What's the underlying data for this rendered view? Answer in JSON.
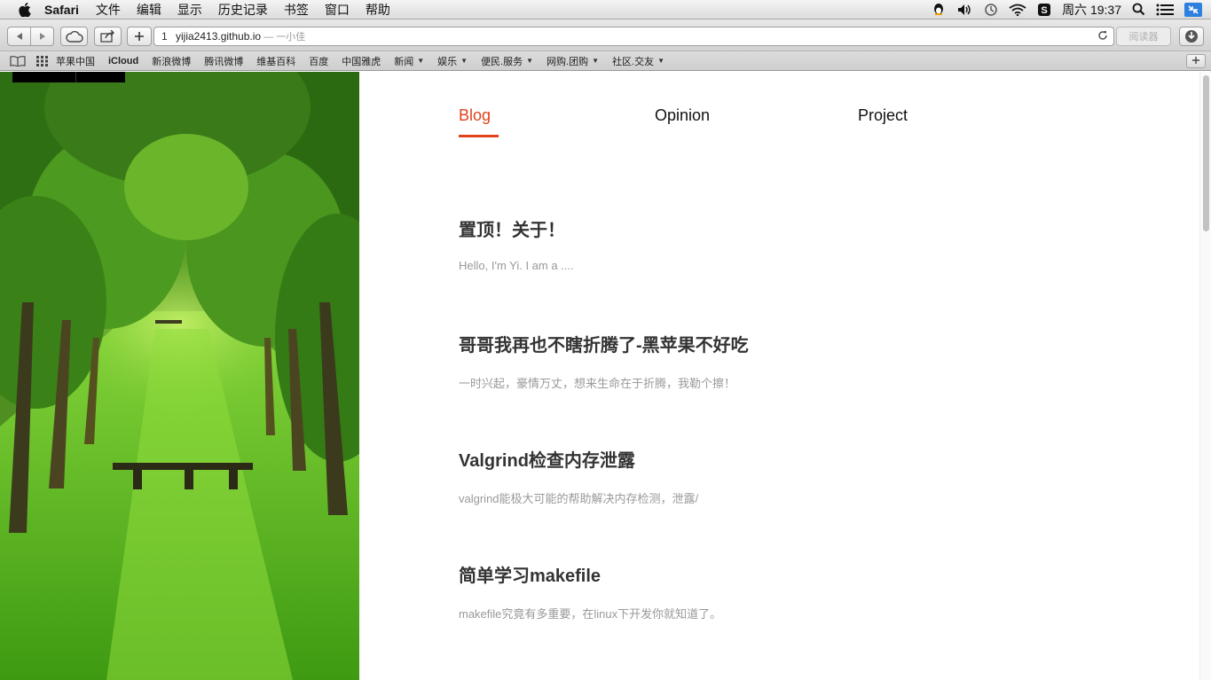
{
  "menubar": {
    "app_name": "Safari",
    "items": [
      "文件",
      "编辑",
      "显示",
      "历史记录",
      "书签",
      "窗口",
      "帮助"
    ],
    "clock": "周六 19:37"
  },
  "toolbar": {
    "tab_count": "1",
    "url_host": "yijia2413.github.io",
    "page_title": "— 一小佳",
    "reader_label": "阅读器"
  },
  "bookmarks": {
    "items": [
      {
        "label": "苹果中国",
        "dropdown": false
      },
      {
        "label": "iCloud",
        "dropdown": false
      },
      {
        "label": "新浪微博",
        "dropdown": false
      },
      {
        "label": "腾讯微博",
        "dropdown": false
      },
      {
        "label": "维基百科",
        "dropdown": false
      },
      {
        "label": "百度",
        "dropdown": false
      },
      {
        "label": "中国雅虎",
        "dropdown": false
      },
      {
        "label": "新闻",
        "dropdown": true
      },
      {
        "label": "娱乐",
        "dropdown": true
      },
      {
        "label": "便民.服务",
        "dropdown": true
      },
      {
        "label": "网购.团购",
        "dropdown": true
      },
      {
        "label": "社区.交友",
        "dropdown": true
      }
    ]
  },
  "nav": {
    "blog": "Blog",
    "opinion": "Opinion",
    "project": "Project",
    "active": "Blog",
    "accent_color": "#e0421b"
  },
  "posts": [
    {
      "title": "置顶！关于！",
      "excerpt": "Hello, I'm Yi. I am a ...."
    },
    {
      "title": "哥哥我再也不瞎折腾了-黑苹果不好吃",
      "excerpt": "一时兴起，豪情万丈，想来生命在于折腾，我勒个擦！"
    },
    {
      "title": "Valgrind检查内存泄露",
      "excerpt": "valgrind能极大可能的帮助解决内存检测，泄露/"
    },
    {
      "title": "简单学习makefile",
      "excerpt": "makefile究竟有多重要，在linux下开发你就知道了。"
    }
  ]
}
